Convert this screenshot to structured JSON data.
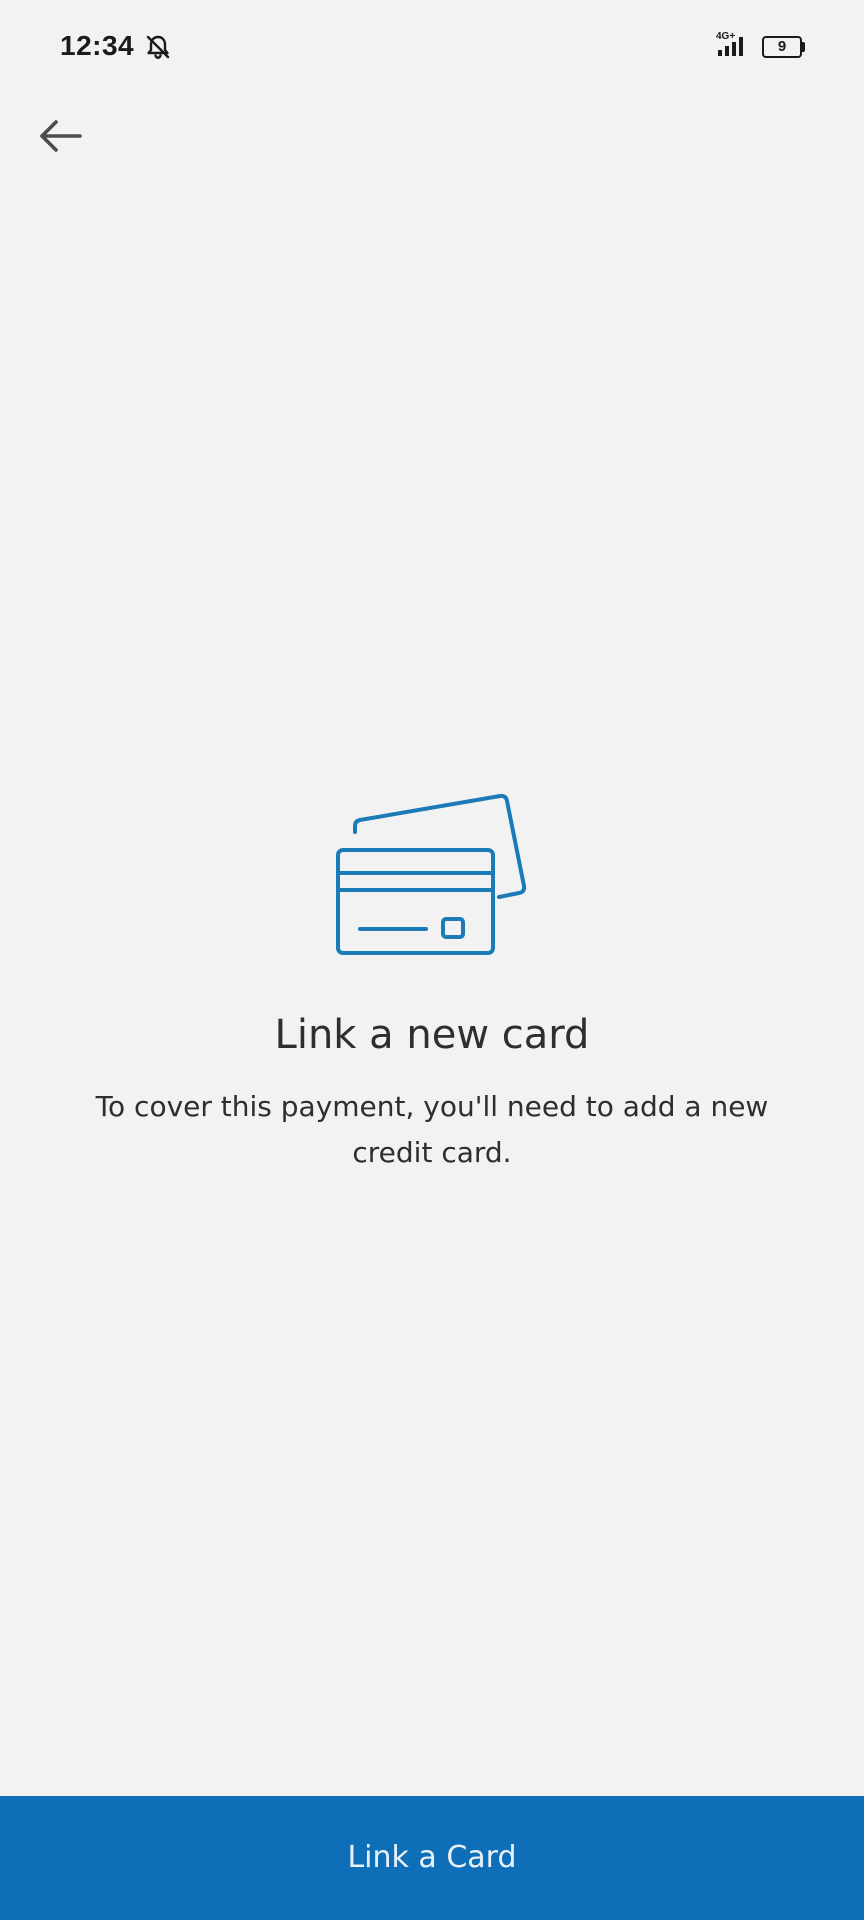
{
  "status_bar": {
    "time": "12:34",
    "mute_icon": "bell-off-icon",
    "network_label": "4G+",
    "battery_level": "9"
  },
  "header": {
    "back_icon": "arrow-left-icon"
  },
  "main": {
    "illustration_icon": "credit-cards-icon",
    "title": "Link a new card",
    "message": "To cover this payment, you'll need to add a new credit card."
  },
  "footer": {
    "button_label": "Link a Card"
  },
  "colors": {
    "background": "#f2f2f2",
    "accent": "#0e6eb8",
    "illustration": "#1b7ab8",
    "text": "#2c2e2f"
  }
}
